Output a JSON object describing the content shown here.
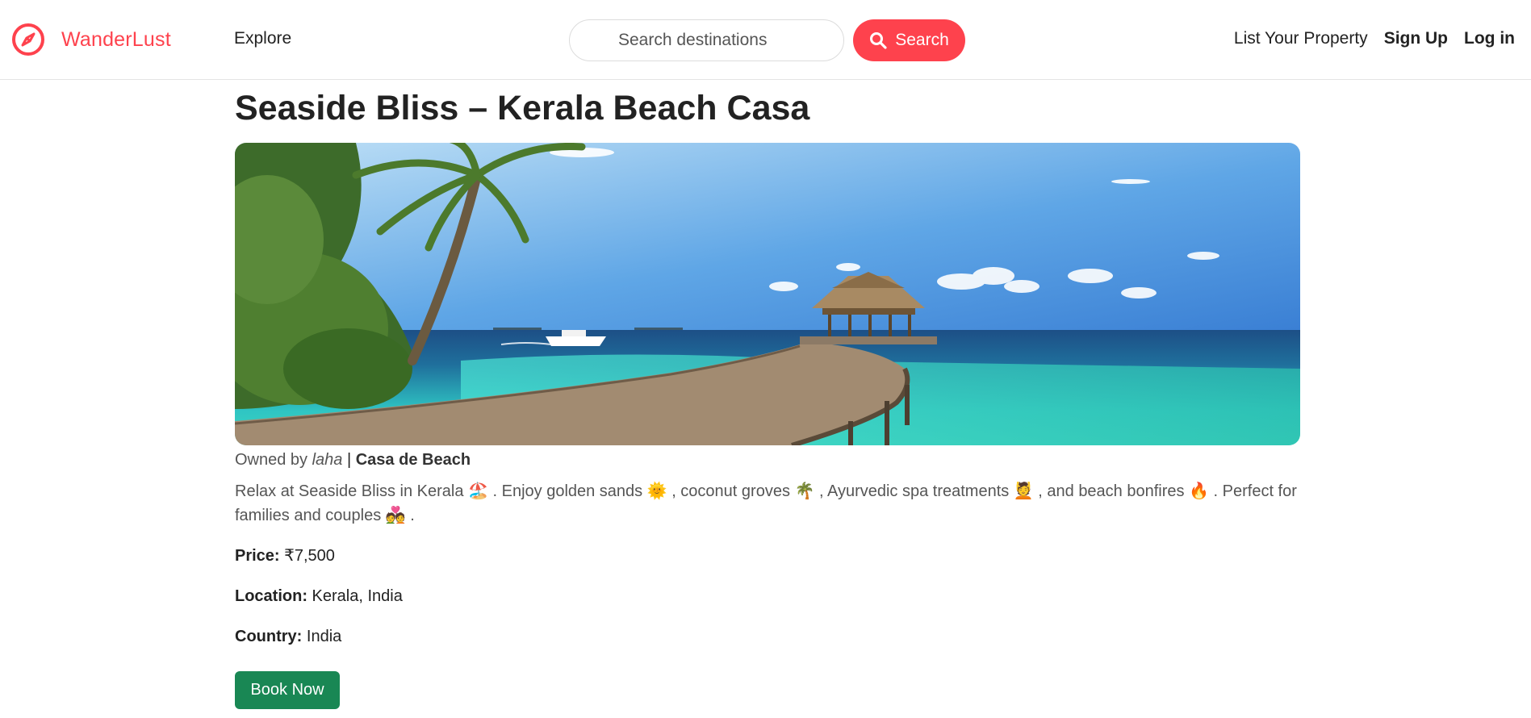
{
  "navbar": {
    "brand": "WanderLust",
    "explore": "Explore",
    "search_placeholder": "Search destinations",
    "search_button": "Search",
    "list_property": "List Your Property",
    "sign_up": "Sign Up",
    "log_in": "Log in"
  },
  "listing": {
    "title": "Seaside Bliss – Kerala Beach Casa",
    "owned_by_prefix": "Owned by ",
    "owner": "laha",
    "separator": " | ",
    "brand": "Casa de Beach",
    "description": "Relax at Seaside Bliss in Kerala 🏖️ . Enjoy golden sands 🌞 , coconut groves 🌴 , Ayurvedic spa treatments 💆 , and beach bonfires 🔥 . Perfect for families and couples 💑 .",
    "price_label": "Price:",
    "price_value": " ₹7,500",
    "location_label": "Location:",
    "location_value": " Kerala, India",
    "country_label": "Country:",
    "country_value": " India",
    "book_button": "Book Now"
  },
  "colors": {
    "brand": "#fe424d",
    "book_button": "#198754"
  },
  "icons": {
    "brand": "compass-icon",
    "search": "search-icon"
  }
}
